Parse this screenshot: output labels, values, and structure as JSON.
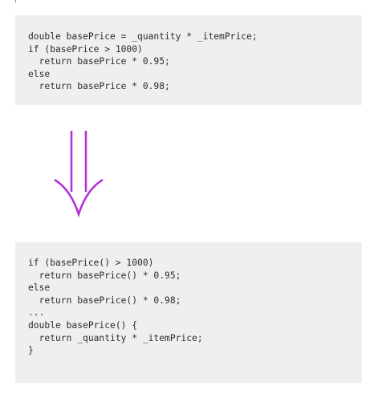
{
  "before_code": {
    "lines": [
      "double basePrice = _quantity * _itemPrice;",
      "if (basePrice > 1000)",
      "  return basePrice * 0.95;",
      "else",
      "  return basePrice * 0.98;"
    ]
  },
  "arrow": {
    "icon": "double-down-arrow-icon",
    "color": "#b532d9"
  },
  "after_code": {
    "lines": [
      "if (basePrice() > 1000)",
      "  return basePrice() * 0.95;",
      "else",
      "  return basePrice() * 0.98;",
      "...",
      "double basePrice() {",
      "  return _quantity * _itemPrice;",
      "}"
    ]
  },
  "colors": {
    "code_background": "#eeefee",
    "code_text": "#2b2b2b",
    "accent": "#b532d9"
  }
}
